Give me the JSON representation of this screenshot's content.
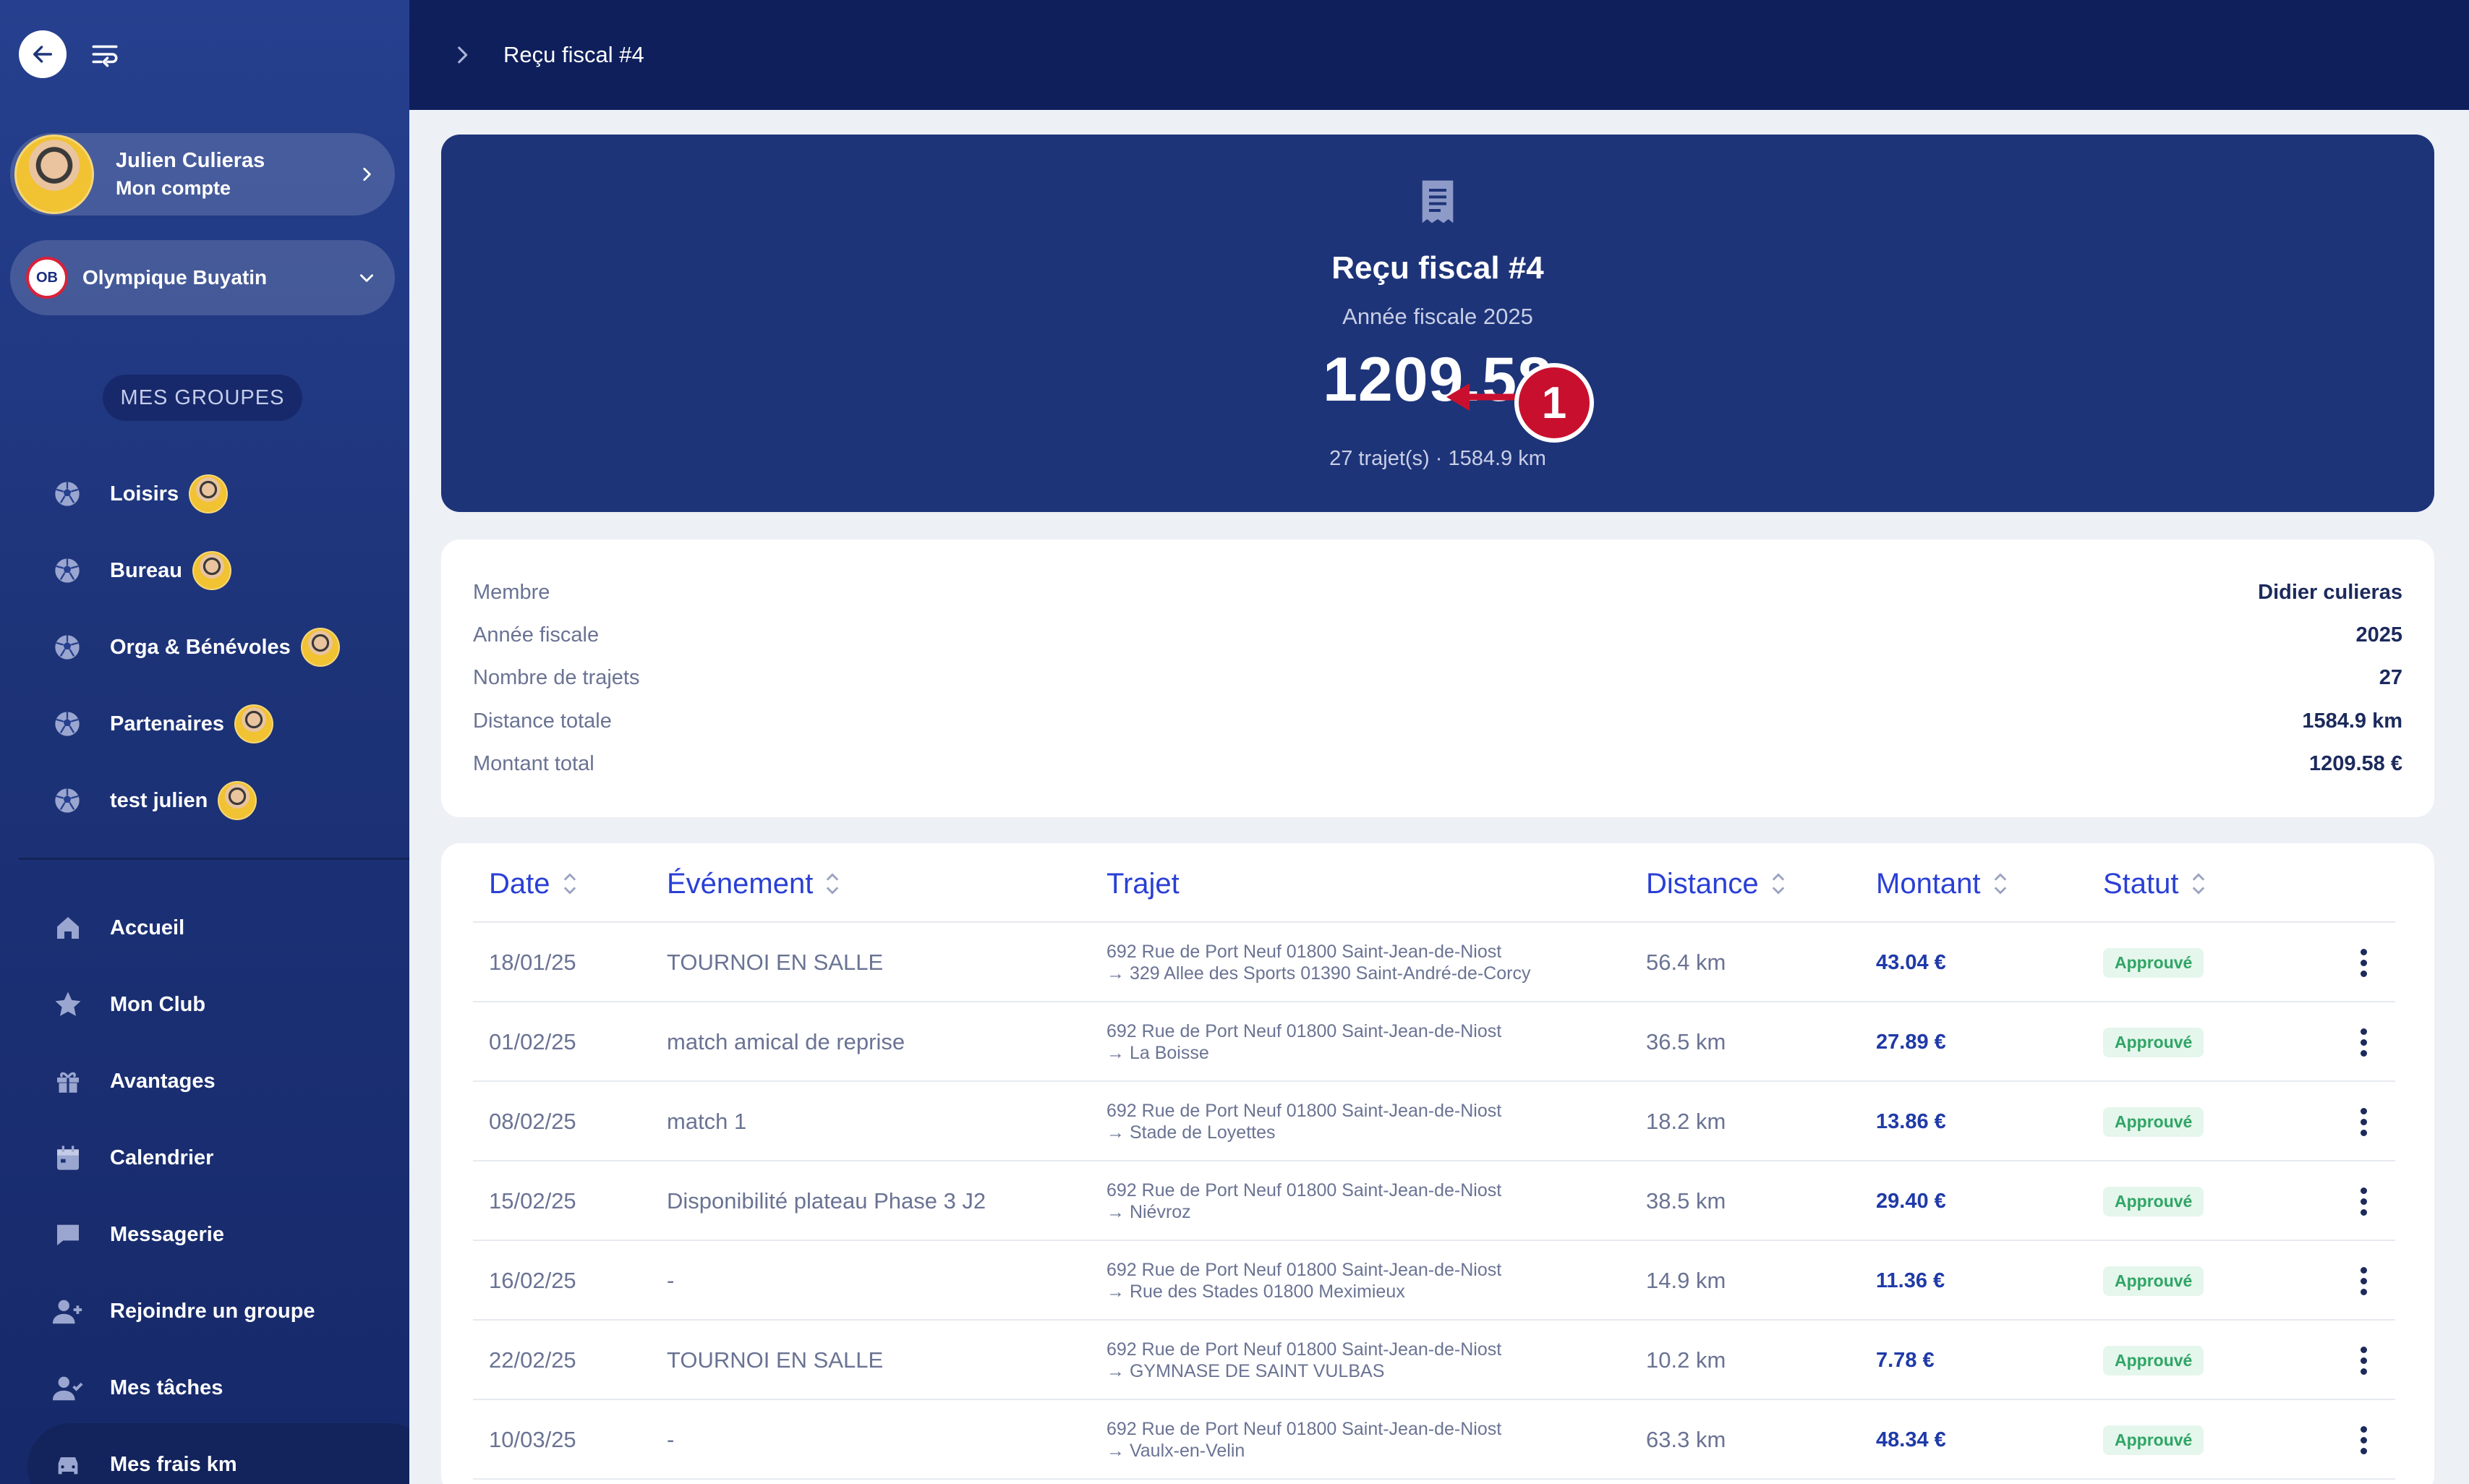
{
  "header": {
    "title": "Reçu fiscal #4"
  },
  "account": {
    "name": "Julien Culieras",
    "subtitle": "Mon compte"
  },
  "club": {
    "name": "Olympique Buyatin",
    "logo_text": "OB"
  },
  "groups": {
    "title": "MES GROUPES",
    "items": [
      {
        "label": "Loisirs"
      },
      {
        "label": "Bureau"
      },
      {
        "label": "Orga & Bénévoles"
      },
      {
        "label": "Partenaires"
      },
      {
        "label": "test julien"
      }
    ]
  },
  "nav": {
    "items": [
      {
        "label": "Accueil",
        "icon": "home-icon"
      },
      {
        "label": "Mon Club",
        "icon": "star-icon"
      },
      {
        "label": "Avantages",
        "icon": "gift-icon"
      },
      {
        "label": "Calendrier",
        "icon": "calendar-icon"
      },
      {
        "label": "Messagerie",
        "icon": "chat-icon"
      },
      {
        "label": "Rejoindre un groupe",
        "icon": "user-plus-icon"
      },
      {
        "label": "Mes tâches",
        "icon": "user-check-icon"
      },
      {
        "label": "Mes frais km",
        "icon": "car-icon"
      }
    ]
  },
  "hero": {
    "title": "Reçu fiscal #4",
    "subtitle": "Année fiscale 2025",
    "amount": "1209.58",
    "stats": "27 trajet(s) · 1584.9 km",
    "annotation": "1"
  },
  "summary": {
    "rows": [
      {
        "label": "Membre",
        "value": "Didier culieras"
      },
      {
        "label": "Année fiscale",
        "value": "2025"
      },
      {
        "label": "Nombre de trajets",
        "value": "27"
      },
      {
        "label": "Distance totale",
        "value": "1584.9 km"
      },
      {
        "label": "Montant total",
        "value": "1209.58 €"
      }
    ]
  },
  "table": {
    "headers": {
      "date": "Date",
      "event": "Événement",
      "route": "Trajet",
      "distance": "Distance",
      "amount": "Montant",
      "status": "Statut"
    },
    "rows": [
      {
        "date": "18/01/25",
        "event": "TOURNOI EN SALLE",
        "from": "692 Rue de Port Neuf 01800 Saint-Jean-de-Niost",
        "to": "→ 329 Allee des Sports 01390 Saint-André-de-Corcy",
        "distance": "56.4 km",
        "amount": "43.04 €",
        "status": "Approuvé"
      },
      {
        "date": "01/02/25",
        "event": "match amical de reprise",
        "from": "692 Rue de Port Neuf 01800 Saint-Jean-de-Niost",
        "to": "→ La Boisse",
        "distance": "36.5 km",
        "amount": "27.89 €",
        "status": "Approuvé"
      },
      {
        "date": "08/02/25",
        "event": "match 1",
        "from": "692 Rue de Port Neuf 01800 Saint-Jean-de-Niost",
        "to": "→ Stade de Loyettes",
        "distance": "18.2 km",
        "amount": "13.86 €",
        "status": "Approuvé"
      },
      {
        "date": "15/02/25",
        "event": "Disponibilité plateau Phase 3 J2",
        "from": "692 Rue de Port Neuf 01800 Saint-Jean-de-Niost",
        "to": "→ Niévroz",
        "distance": "38.5 km",
        "amount": "29.40 €",
        "status": "Approuvé"
      },
      {
        "date": "16/02/25",
        "event": "-",
        "from": "692 Rue de Port Neuf 01800 Saint-Jean-de-Niost",
        "to": "→ Rue des Stades 01800 Meximieux",
        "distance": "14.9 km",
        "amount": "11.36 €",
        "status": "Approuvé"
      },
      {
        "date": "22/02/25",
        "event": "TOURNOI EN SALLE",
        "from": "692 Rue de Port Neuf 01800 Saint-Jean-de-Niost",
        "to": "→ GYMNASE DE SAINT VULBAS",
        "distance": "10.2 km",
        "amount": "7.78 €",
        "status": "Approuvé"
      },
      {
        "date": "10/03/25",
        "event": "-",
        "from": "692 Rue de Port Neuf 01800 Saint-Jean-de-Niost",
        "to": "→ Vaulx-en-Velin",
        "distance": "63.3 km",
        "amount": "48.34 €",
        "status": "Approuvé"
      }
    ]
  },
  "colors": {
    "sidebar": "#1d3378",
    "header": "#0f1f5c",
    "hero": "#1e3479",
    "accent": "#2a3fd6",
    "status_green": "#2fa565",
    "annotation": "#c8102e"
  }
}
